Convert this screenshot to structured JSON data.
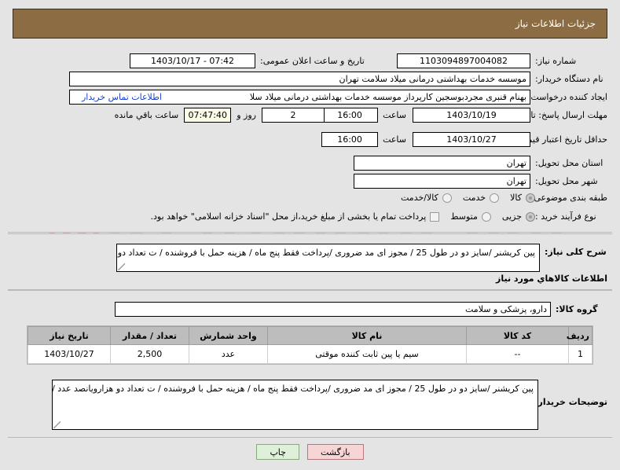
{
  "header": {
    "title": "جزئیات اطلاعات نیاز"
  },
  "watermark": {
    "text": "iriatender.net"
  },
  "info": {
    "need_number_label": "شماره نیاز:",
    "need_number_value": "1103094897004082",
    "announce_label": "تاریخ و ساعت اعلان عمومی:",
    "announce_value": "07:42 - 1403/10/17",
    "buyer_org_label": "نام دستگاه خریدار:",
    "buyer_org_value": "موسسه خدمات بهداشتی درمانی میلاد سلامت تهران",
    "requester_label": "ایجاد کننده درخواست:",
    "requester_value": "بهنام قنبری مجردبوسجین کارپرداز موسسه خدمات بهداشتی درمانی میلاد سلا",
    "contact_link": "اطلاعات تماس خریدار",
    "deadline_label": "مهلت ارسال پاسخ: تا تاریخ:",
    "deadline_date": "1403/10/19",
    "deadline_hour_label": "ساعت",
    "deadline_hour": "16:00",
    "remaining_days": "2",
    "remaining_days_label": "روز و",
    "remaining_time": "07:47:40",
    "remaining_time_label": "ساعت باقي مانده",
    "validity_label": "حداقل تاریخ اعتبار قیمت: تا تاریخ:",
    "validity_date": "1403/10/27",
    "validity_hour_label": "ساعت",
    "validity_hour": "16:00",
    "province_label": "استان محل تحویل:",
    "province_value": "تهران",
    "city_label": "شهر محل تحویل:",
    "city_value": "تهران",
    "category_label": "طبقه بندی موضوعی:",
    "category_options": [
      "کالا",
      "خدمت",
      "کالا/خدمت"
    ],
    "category_selected_index": 0,
    "process_label": "نوع فرآیند خرید :",
    "process_options": [
      "جزیی",
      "متوسط"
    ],
    "process_selected_index": 0,
    "treasury_note": "پرداخت تمام یا بخشی از مبلغ خرید،از محل \"اسناد خزانه اسلامی\" خواهد بود."
  },
  "description": {
    "label": "شرح کلی نیاز:",
    "value": "پین کریشنر /سایز دو در طول 25 / مجوز ای مد ضروری /پرداخت فقط پنج  ماه / هزینه حمل با فروشنده / ت تعداد دو هزارویانصد  عدد /"
  },
  "goods": {
    "section_title": "اطلاعات کالاهاي مورد نیاز",
    "group_label": "گروه کالا:",
    "group_value": "دارو، پزشکی و سلامت",
    "columns": [
      "ردیف",
      "کد کالا",
      "نام کالا",
      "واحد شمارش",
      "تعداد / مقدار",
      "تاریخ نیاز"
    ],
    "rows": [
      {
        "row": "1",
        "code": "--",
        "name": "سیم یا پین ثابت کننده موقتی",
        "unit": "عدد",
        "quantity": "2,500",
        "need_date": "1403/10/27"
      }
    ]
  },
  "notes": {
    "label": "توضیحات خریدار:",
    "value": "پین کریشنر /سایز دو در طول 25 / مجوز ای مد ضروری /پرداخت فقط پنج  ماه / هزینه حمل با فروشنده / ت تعداد دو هزارویانصد  عدد / شرکتهای که نمی توانند یکجا کالا را ظرف مدت  20 روز تامین نمایند لطفا شرکت نکنند / لطفا پیوست حتما خوانده شود"
  },
  "buttons": {
    "back": "بازگشت",
    "print": "چاپ"
  },
  "colors": {
    "header_bg": "#8c6d43",
    "page_bg": "#e4e4e4",
    "link": "#1a3fd0",
    "table_header_bg": "#bdbdbd",
    "back_btn_bg": "#f7d4d6",
    "print_btn_bg": "#dff0d8",
    "timer_bg": "#fbfbe8"
  }
}
